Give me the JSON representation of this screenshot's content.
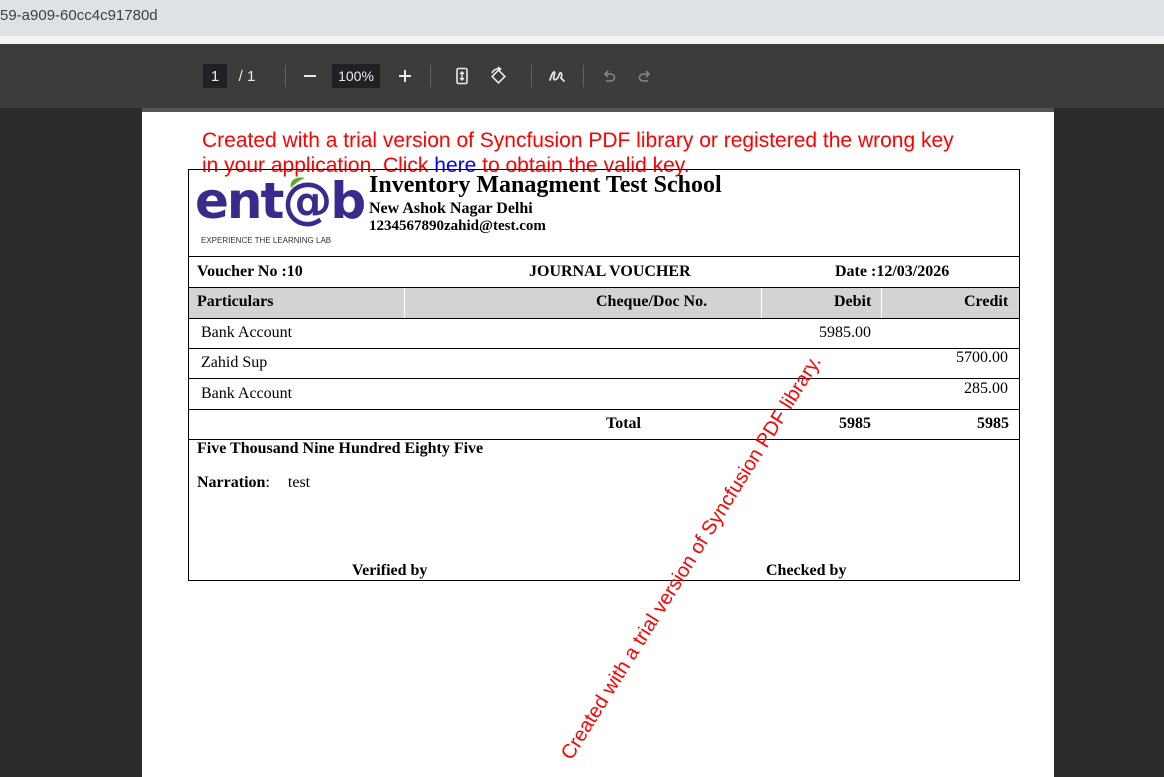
{
  "browser": {
    "url_fragment": "59-a909-60cc4c91780d"
  },
  "toolbar": {
    "current_page": "1",
    "total_pages": "/  1",
    "zoom": "100%"
  },
  "trial_notice": {
    "line1": "Created with a trial version of Syncfusion PDF library or registered the wrong key",
    "line2_a": "in your application. Click ",
    "link": "here",
    "line2_b": " to obtain the valid key."
  },
  "logo": {
    "wordmark": "ent@b",
    "tagline": "EXPERIENCE THE LEARNING LAB"
  },
  "school": {
    "name": "Inventory Managment Test School",
    "address": "New Ashok Nagar Delhi",
    "contact": "1234567890zahid@test.com"
  },
  "voucher": {
    "number_label": "Voucher No :10",
    "type": "JOURNAL VOUCHER",
    "date_label": "Date :12/03/2026"
  },
  "table": {
    "headers": {
      "particulars": "Particulars",
      "cheque": "Cheque/Doc No.",
      "debit": "Debit",
      "credit": "Credit"
    },
    "rows": [
      {
        "particulars": "Bank Account",
        "debit": "5985.00",
        "credit": ""
      },
      {
        "particulars": "Zahid Sup",
        "debit": "",
        "credit": "5700.00"
      },
      {
        "particulars": "Bank Account",
        "debit": "",
        "credit": "285.00"
      }
    ],
    "total": {
      "label": "Total",
      "debit": "5985",
      "credit": "5985"
    }
  },
  "amount_in_words": "Five Thousand Nine Hundred Eighty Five",
  "narration": {
    "label": "Narration",
    "colon": ":",
    "value": "test"
  },
  "signatures": {
    "verified": "Verified by",
    "checked": "Checked by"
  },
  "watermark": "Created with a trial version of Syncfusion PDF library."
}
